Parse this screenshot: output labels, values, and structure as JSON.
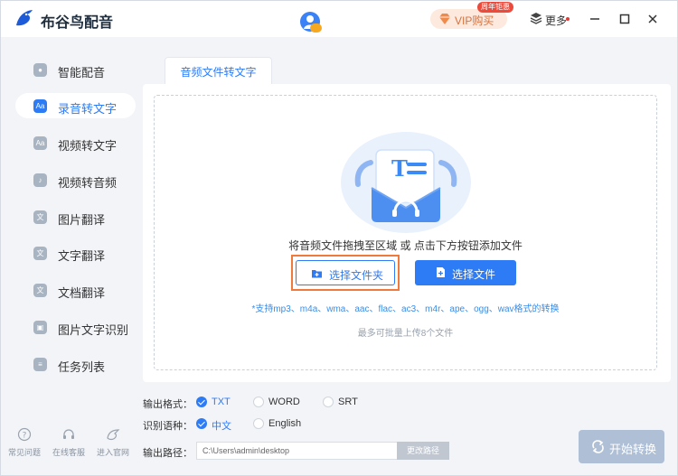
{
  "app": {
    "title": "布谷鸟配音"
  },
  "header": {
    "vip": {
      "label": "VIP购买",
      "ribbon": "周年钜惠"
    },
    "more_label": "更多"
  },
  "sidebar": {
    "items": [
      {
        "label": "智能配音",
        "icon": "mic-icon"
      },
      {
        "label": "录音转文字",
        "icon": "audio-to-text-icon",
        "active": true
      },
      {
        "label": "视频转文字",
        "icon": "video-to-text-icon"
      },
      {
        "label": "视频转音频",
        "icon": "video-to-audio-icon"
      },
      {
        "label": "图片翻译",
        "icon": "image-translate-icon"
      },
      {
        "label": "文字翻译",
        "icon": "text-translate-icon"
      },
      {
        "label": "文档翻译",
        "icon": "doc-translate-icon"
      },
      {
        "label": "图片文字识别",
        "icon": "ocr-icon"
      },
      {
        "label": "任务列表",
        "icon": "task-list-icon"
      }
    ],
    "bottom": [
      {
        "label": "常见问题",
        "icon": "question-icon"
      },
      {
        "label": "在线客服",
        "icon": "headset-icon"
      },
      {
        "label": "进入官网",
        "icon": "website-icon"
      }
    ]
  },
  "main": {
    "tab_label": "音频文件转文字",
    "drop_hint": "将音频文件拖拽至区域 或 点击下方按钮添加文件",
    "select_folder_label": "选择文件夹",
    "select_file_label": "选择文件",
    "supported_formats": "*支持mp3、m4a、wma、aac、flac、ac3、m4r、ape、ogg、wav格式的转换",
    "limit_text": "最多可批量上传8个文件"
  },
  "options": {
    "output_format": {
      "label": "输出格式：",
      "choices": [
        "TXT",
        "WORD",
        "SRT"
      ],
      "selected": "TXT"
    },
    "language": {
      "label": "识别语种：",
      "choices": [
        "中文",
        "English"
      ],
      "selected": "中文"
    },
    "output_path": {
      "label": "输出路径：",
      "value": "C:\\Users\\admin\\desktop",
      "change_label": "更改路径"
    }
  },
  "start_label": "开始转换",
  "colors": {
    "accent": "#2e7bf6",
    "highlight_outline": "#f07a3c",
    "vip": "#d5733f"
  }
}
